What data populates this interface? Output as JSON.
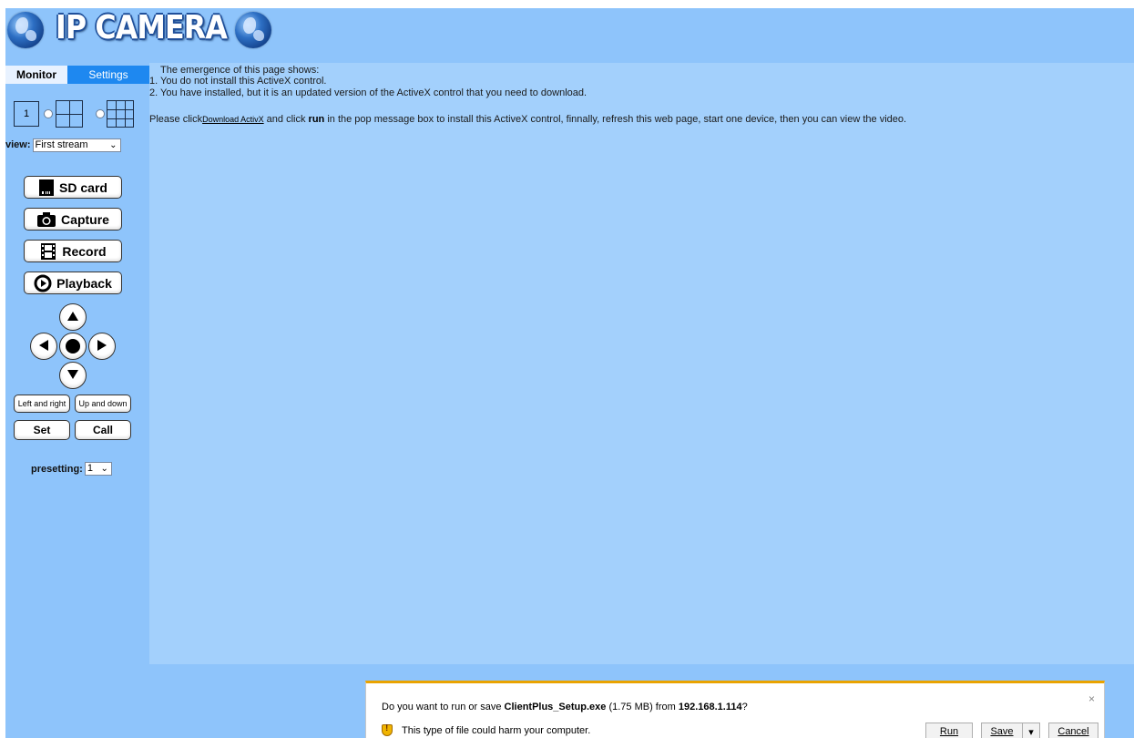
{
  "header": {
    "title": "IP CAMERA"
  },
  "tabs": [
    {
      "label": "Monitor",
      "active": true
    },
    {
      "label": "Settings",
      "active": false
    }
  ],
  "sidebar": {
    "layout_one_label": "1",
    "view_label": "view:",
    "view_select_value": "First stream",
    "buttons": {
      "sd_card": "SD card",
      "capture": "Capture",
      "record": "Record",
      "playback": "Playback",
      "left_right": "Left and right",
      "up_down": "Up and down",
      "set": "Set",
      "call": "Call"
    },
    "preset_label": "presetting:",
    "preset_value": "1"
  },
  "content": {
    "line1": "The emergence of this page shows:",
    "line2": "1. You do not install this ActiveX control.",
    "line3": "2. You have installed, but it is an updated version of the ActiveX control that you need to download.",
    "please_prefix": "Please click",
    "download_link": "Download ActivX",
    "please_middle": " and click ",
    "run_word": "run",
    "please_suffix": " in the pop message box to install this ActiveX control, finnally, refresh this web page, start one device, then you can view the video."
  },
  "download_bar": {
    "question_prefix": "Do you want to run or save ",
    "filename": "ClientPlus_Setup.exe",
    "size": " (1.75 MB) from ",
    "host": "192.168.1.114",
    "question_suffix": "?",
    "warning": "This type of file could harm your computer.",
    "run_label": "Run",
    "save_label": "Save",
    "save_dropdown": "▾",
    "cancel_label": "Cancel",
    "close_glyph": "×"
  },
  "colors": {
    "page_bg": "#8ec4fb",
    "content_bg": "#a3d0fc",
    "tab_active_bg": "#e8f2ff",
    "tab_inactive_bg": "#1e88f0",
    "warning_accent": "#e9a300"
  }
}
